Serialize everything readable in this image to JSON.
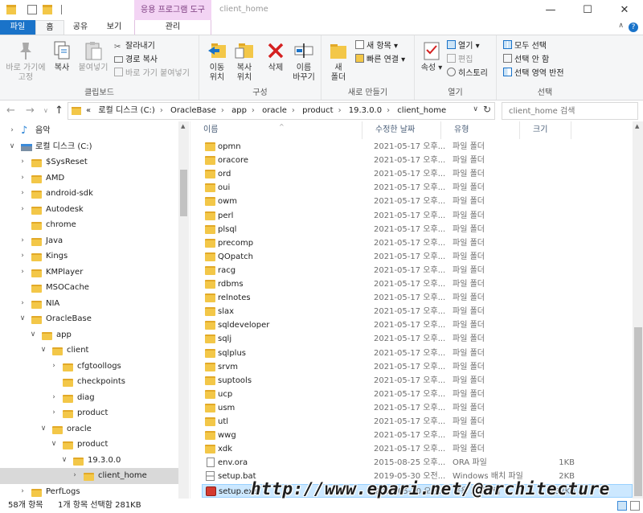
{
  "titlebar": {
    "contextual_tab_group": "응용 프로그램 도구",
    "window_title": "client_home",
    "minimize": "—",
    "maximize": "☐",
    "close": "✕"
  },
  "ribbon_tabs": {
    "file": "파일",
    "home": "홈",
    "share": "공유",
    "view": "보기",
    "manage": "관리"
  },
  "ribbon": {
    "clipboard": {
      "label": "클립보드",
      "pin_quick_access": "바로 가기에\n고정",
      "copy": "복사",
      "paste": "붙여넣기",
      "cut": "잘라내기",
      "copy_path": "경로 복사",
      "paste_shortcut": "바로 가기 붙여넣기"
    },
    "organize": {
      "label": "구성",
      "move_to": "이동\n위치",
      "copy_to": "복사\n위치",
      "delete": "삭제",
      "rename": "이름\n바꾸기"
    },
    "new": {
      "label": "새로 만들기",
      "new_folder": "새\n폴더",
      "new_item": "새 항목",
      "easy_access": "빠른 연결"
    },
    "open": {
      "label": "열기",
      "properties": "속성",
      "open": "열기",
      "edit": "편집",
      "history": "히스토리"
    },
    "select": {
      "label": "선택",
      "select_all": "모두 선택",
      "select_none": "선택 안 함",
      "invert": "선택 영역 반전"
    }
  },
  "address": {
    "crumbs": [
      "«",
      "로컬 디스크 (C:)",
      "OracleBase",
      "app",
      "oracle",
      "product",
      "19.3.0.0",
      "client_home"
    ],
    "search_placeholder": "client_home 검색"
  },
  "nav_tree": [
    {
      "label": "음악",
      "level": 0,
      "chevron": ">",
      "icon": "music-icon"
    },
    {
      "label": "로컬 디스크 (C:)",
      "level": 0,
      "chevron": "v",
      "icon": "drive-icon"
    },
    {
      "label": "$SysReset",
      "level": 1,
      "chevron": ">",
      "icon": "folder-icon"
    },
    {
      "label": "AMD",
      "level": 1,
      "chevron": ">",
      "icon": "folder-icon"
    },
    {
      "label": "android-sdk",
      "level": 1,
      "chevron": ">",
      "icon": "folder-icon"
    },
    {
      "label": "Autodesk",
      "level": 1,
      "chevron": ">",
      "icon": "folder-icon"
    },
    {
      "label": "chrome",
      "level": 1,
      "chevron": "",
      "icon": "folder-icon"
    },
    {
      "label": "Java",
      "level": 1,
      "chevron": ">",
      "icon": "folder-icon"
    },
    {
      "label": "Kings",
      "level": 1,
      "chevron": ">",
      "icon": "folder-icon"
    },
    {
      "label": "KMPlayer",
      "level": 1,
      "chevron": ">",
      "icon": "folder-icon"
    },
    {
      "label": "MSOCache",
      "level": 1,
      "chevron": "",
      "icon": "folder-icon"
    },
    {
      "label": "NIA",
      "level": 1,
      "chevron": ">",
      "icon": "folder-icon"
    },
    {
      "label": "OracleBase",
      "level": 1,
      "chevron": "v",
      "icon": "folder-icon"
    },
    {
      "label": "app",
      "level": 2,
      "chevron": "v",
      "icon": "folder-icon"
    },
    {
      "label": "client",
      "level": 3,
      "chevron": "v",
      "icon": "folder-icon"
    },
    {
      "label": "cfgtoollogs",
      "level": 4,
      "chevron": ">",
      "icon": "folder-icon"
    },
    {
      "label": "checkpoints",
      "level": 4,
      "chevron": "",
      "icon": "folder-icon"
    },
    {
      "label": "diag",
      "level": 4,
      "chevron": ">",
      "icon": "folder-icon"
    },
    {
      "label": "product",
      "level": 4,
      "chevron": ">",
      "icon": "folder-icon"
    },
    {
      "label": "oracle",
      "level": 3,
      "chevron": "v",
      "icon": "folder-icon"
    },
    {
      "label": "product",
      "level": 4,
      "chevron": "v",
      "icon": "folder-icon"
    },
    {
      "label": "19.3.0.0",
      "level": 5,
      "chevron": "v",
      "icon": "folder-icon"
    },
    {
      "label": "client_home",
      "level": 6,
      "chevron": ">",
      "icon": "folder-icon",
      "selected": true
    },
    {
      "label": "PerfLogs",
      "level": 1,
      "chevron": ">",
      "icon": "folder-icon"
    }
  ],
  "columns": {
    "name": "이름",
    "date": "수정한 날짜",
    "type": "유형",
    "size": "크기"
  },
  "files": [
    {
      "name": "opmn",
      "date": "2021-05-17 오후...",
      "type": "파일 폴더",
      "size": "",
      "kind": "folder"
    },
    {
      "name": "oracore",
      "date": "2021-05-17 오후...",
      "type": "파일 폴더",
      "size": "",
      "kind": "folder"
    },
    {
      "name": "ord",
      "date": "2021-05-17 오후...",
      "type": "파일 폴더",
      "size": "",
      "kind": "folder"
    },
    {
      "name": "oui",
      "date": "2021-05-17 오후...",
      "type": "파일 폴더",
      "size": "",
      "kind": "folder"
    },
    {
      "name": "owm",
      "date": "2021-05-17 오후...",
      "type": "파일 폴더",
      "size": "",
      "kind": "folder"
    },
    {
      "name": "perl",
      "date": "2021-05-17 오후...",
      "type": "파일 폴더",
      "size": "",
      "kind": "folder"
    },
    {
      "name": "plsql",
      "date": "2021-05-17 오후...",
      "type": "파일 폴더",
      "size": "",
      "kind": "folder"
    },
    {
      "name": "precomp",
      "date": "2021-05-17 오후...",
      "type": "파일 폴더",
      "size": "",
      "kind": "folder"
    },
    {
      "name": "QOpatch",
      "date": "2021-05-17 오후...",
      "type": "파일 폴더",
      "size": "",
      "kind": "folder"
    },
    {
      "name": "racg",
      "date": "2021-05-17 오후...",
      "type": "파일 폴더",
      "size": "",
      "kind": "folder"
    },
    {
      "name": "rdbms",
      "date": "2021-05-17 오후...",
      "type": "파일 폴더",
      "size": "",
      "kind": "folder"
    },
    {
      "name": "relnotes",
      "date": "2021-05-17 오후...",
      "type": "파일 폴더",
      "size": "",
      "kind": "folder"
    },
    {
      "name": "slax",
      "date": "2021-05-17 오후...",
      "type": "파일 폴더",
      "size": "",
      "kind": "folder"
    },
    {
      "name": "sqldeveloper",
      "date": "2021-05-17 오후...",
      "type": "파일 폴더",
      "size": "",
      "kind": "folder"
    },
    {
      "name": "sqlj",
      "date": "2021-05-17 오후...",
      "type": "파일 폴더",
      "size": "",
      "kind": "folder"
    },
    {
      "name": "sqlplus",
      "date": "2021-05-17 오후...",
      "type": "파일 폴더",
      "size": "",
      "kind": "folder"
    },
    {
      "name": "srvm",
      "date": "2021-05-17 오후...",
      "type": "파일 폴더",
      "size": "",
      "kind": "folder"
    },
    {
      "name": "suptools",
      "date": "2021-05-17 오후...",
      "type": "파일 폴더",
      "size": "",
      "kind": "folder"
    },
    {
      "name": "ucp",
      "date": "2021-05-17 오후...",
      "type": "파일 폴더",
      "size": "",
      "kind": "folder"
    },
    {
      "name": "usm",
      "date": "2021-05-17 오후...",
      "type": "파일 폴더",
      "size": "",
      "kind": "folder"
    },
    {
      "name": "utl",
      "date": "2021-05-17 오후...",
      "type": "파일 폴더",
      "size": "",
      "kind": "folder"
    },
    {
      "name": "wwg",
      "date": "2021-05-17 오후...",
      "type": "파일 폴더",
      "size": "",
      "kind": "folder"
    },
    {
      "name": "xdk",
      "date": "2021-05-17 오후...",
      "type": "파일 폴더",
      "size": "",
      "kind": "folder"
    },
    {
      "name": "env.ora",
      "date": "2015-08-25 오후...",
      "type": "ORA 파일",
      "size": "1KB",
      "kind": "file"
    },
    {
      "name": "setup.bat",
      "date": "2019-05-30 오전...",
      "type": "Windows 배치 파일",
      "size": "2KB",
      "kind": "bat"
    },
    {
      "name": "setup.exe",
      "date": "2019-05-30 오전...",
      "type": "응용 프로그램",
      "size": "282KB",
      "kind": "exe",
      "selected": true
    }
  ],
  "status": {
    "count": "58개 항목",
    "selection": "1개 항목 선택함 281KB"
  },
  "watermark": "http://www.epari.net/@architecture",
  "colors": {
    "accent": "#1a73c9",
    "folder": "#f3c748",
    "selection": "#cce8ff",
    "contextual_tab": "#f3d4f4"
  }
}
